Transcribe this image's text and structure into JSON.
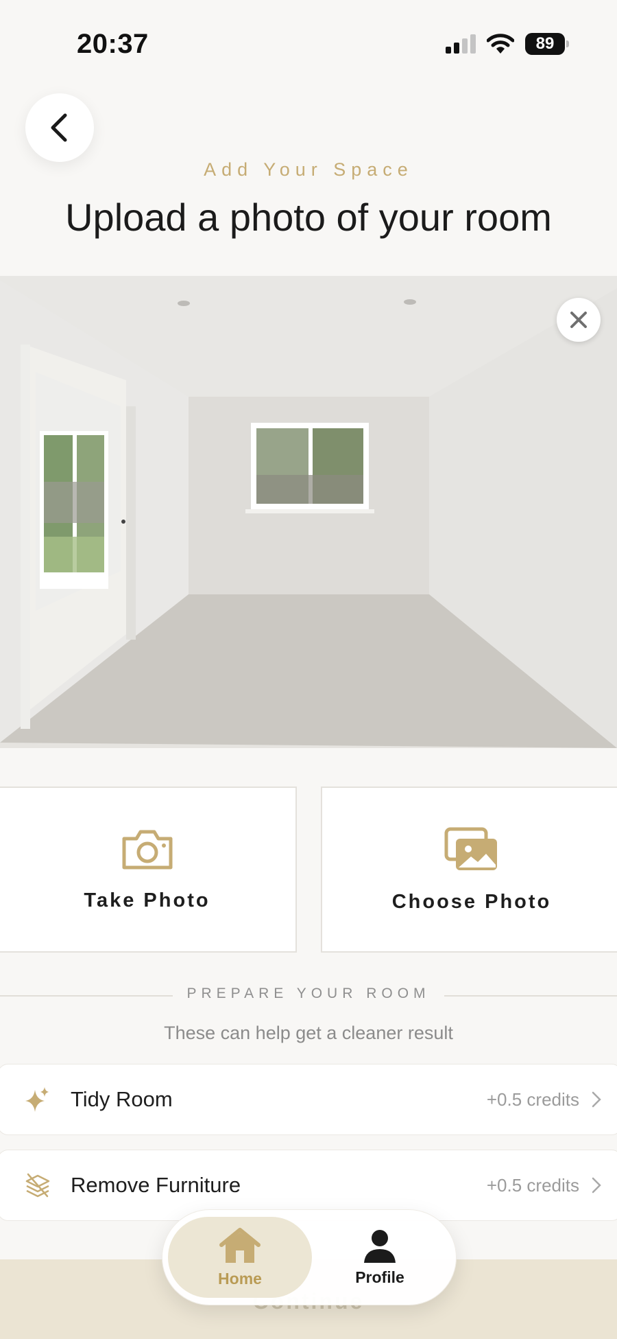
{
  "status_bar": {
    "time": "20:37",
    "battery": "89"
  },
  "header": {
    "eyebrow": "Add Your Space",
    "title": "Upload a photo of your room"
  },
  "actions": {
    "take_photo": "Take Photo",
    "choose_photo": "Choose Photo"
  },
  "prepare": {
    "title": "PREPARE YOUR ROOM",
    "subtitle": "These can help get a cleaner result",
    "options": [
      {
        "label": "Tidy Room",
        "credits": "+0.5 credits",
        "icon": "sparkles-icon"
      },
      {
        "label": "Remove Furniture",
        "credits": "+0.5 credits",
        "icon": "layers-icon"
      }
    ]
  },
  "continue_label": "Continue",
  "tabbar": {
    "home": "Home",
    "profile": "Profile"
  },
  "colors": {
    "accent": "#C6AC74",
    "background": "#F8F7F5",
    "tab_active": "#ECE6D4"
  }
}
